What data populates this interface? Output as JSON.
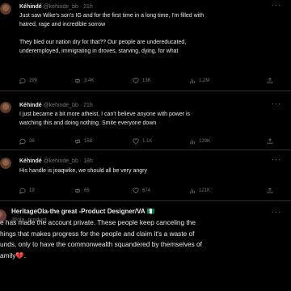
{
  "tweets": [
    {
      "name": "Kéhindé",
      "handle": "@kehinde_bb · 21h",
      "lines": [
        "Just saw Wike's son's IG and for the first time in a long time, I'm filled with",
        "hatred, rage and incredible sorrow",
        "",
        "They bled our nation dry for that?? Our people are undereducated,",
        "underemployed, immigrating in droves, starving, dying, for what"
      ],
      "stats": {
        "replies": "299",
        "reposts": "3.4K",
        "likes": "13K",
        "views": "1.2M"
      }
    },
    {
      "name": "Kéhindé",
      "handle": "@kehinde_bb · 21h",
      "lines": [
        "I just became a bit more atheist, I can't believe anyone with power is",
        "watching this and doing nothing. Smite everyone down"
      ],
      "stats": {
        "replies": "36",
        "reposts": "158",
        "likes": "1.1K",
        "views": "129K"
      }
    },
    {
      "name": "Kéhindé",
      "handle": "@kehinde_bb · 18h",
      "lines": [
        "His handle is joaqwike, we should all be very angry"
      ],
      "stats": {
        "replies": "19",
        "reposts": "65",
        "likes": "674",
        "views": "121K"
      }
    }
  ],
  "main": {
    "name": "HeritageOla-the great -Product Designer/VA",
    "flag": "🇳🇬",
    "handle": "@ola_product",
    "lines": [
      "e has made the account private. These people keep canceling the",
      "hings that makes progress for the people and claim it's a waste of",
      "unds, only to have the commonwealth squandered by themselves of",
      "amily💔."
    ]
  },
  "more_label": "···"
}
